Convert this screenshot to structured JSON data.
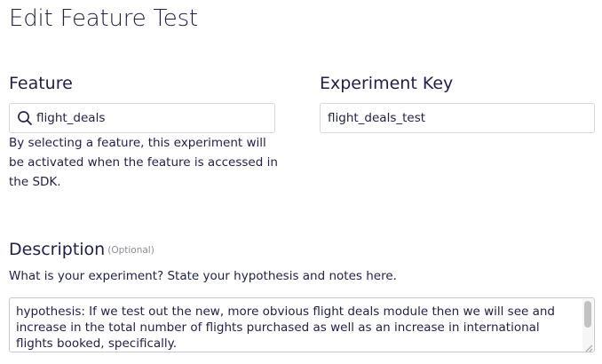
{
  "page": {
    "title": "Edit Feature Test"
  },
  "feature": {
    "label": "Feature",
    "value": "flight_deals",
    "icon": "search-icon",
    "helper": "By selecting a feature, this experiment will be activated when the feature is accessed in the SDK."
  },
  "experiment_key": {
    "label": "Experiment Key",
    "value": "flight_deals_test"
  },
  "description": {
    "label": "Description",
    "optional_tag": "(Optional)",
    "prompt": "What is your experiment? State your hypothesis and notes here.",
    "value": "hypothesis: If we test out the new, more obvious flight deals module then we will see and increase in the total number of flights purchased as well as an increase in international flights booked, specifically."
  },
  "colors": {
    "text": "#1f1f4a",
    "border": "#d6d6dc",
    "muted": "#8c8c99"
  }
}
